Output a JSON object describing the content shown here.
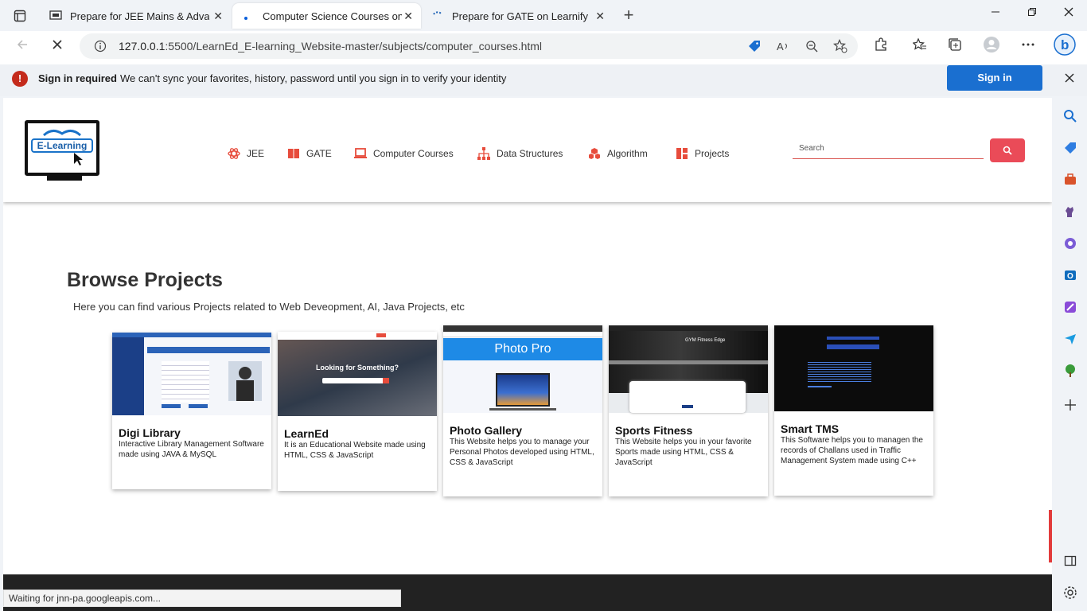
{
  "browser": {
    "tabs": [
      {
        "title": "Prepare for JEE Mains & Advanc",
        "close": "✕"
      },
      {
        "title": "Computer Science Courses on Le",
        "close": "✕"
      },
      {
        "title": "Prepare for GATE on Learnify",
        "close": "✕"
      }
    ],
    "new_tab": "+",
    "url_host": "127.0.0.1",
    "url_path": ":5500/LearnEd_E-learning_Website-master/subjects/computer_courses.html",
    "colors": {
      "accent": "#0a5fdb",
      "signin": "#1a6fd0"
    }
  },
  "infobar": {
    "title": "Sign in required",
    "message": "We can't sync your favorites, history, password until you sign in to verify your identity",
    "button": "Sign in"
  },
  "site": {
    "logo_text": "E-Learning",
    "nav": [
      {
        "label": "JEE",
        "icon": "atom-icon"
      },
      {
        "label": "GATE",
        "icon": "book-icon"
      },
      {
        "label": "Computer Courses",
        "icon": "laptop-icon"
      },
      {
        "label": "Data Structures",
        "icon": "sitemap-icon"
      },
      {
        "label": "Algorithm",
        "icon": "cubes-icon"
      },
      {
        "label": "Projects",
        "icon": "grid-icon"
      }
    ],
    "search_placeholder": "Search",
    "heading": "Browse Projects",
    "subheading": "Here you can find various Projects related to Web Deveopment, AI, Java Projects, etc",
    "projects": [
      {
        "title": "Digi Library",
        "desc": "Interactive Library Management Software made using JAVA & MySQL"
      },
      {
        "title": "LearnEd",
        "desc": "It is an Educational Website made using HTML, CSS & JavaScript",
        "img_text": "Looking for Something?"
      },
      {
        "title": "Photo Gallery",
        "desc": "This Website helps you to manage your Personal Photos developed using HTML, CSS & JavaScript",
        "img_text": "Photo Pro"
      },
      {
        "title": "Sports Fitness",
        "desc": "This Website helps you in your favorite Sports made using HTML, CSS & JavaScript",
        "img_text": "GYM Fitness Edge"
      },
      {
        "title": "Smart TMS",
        "desc": "This Software helps you to managen the records of Challans used in Traffic Management System made using C++"
      }
    ]
  },
  "status_text": "Waiting for jnn-pa.googleapis.com..."
}
